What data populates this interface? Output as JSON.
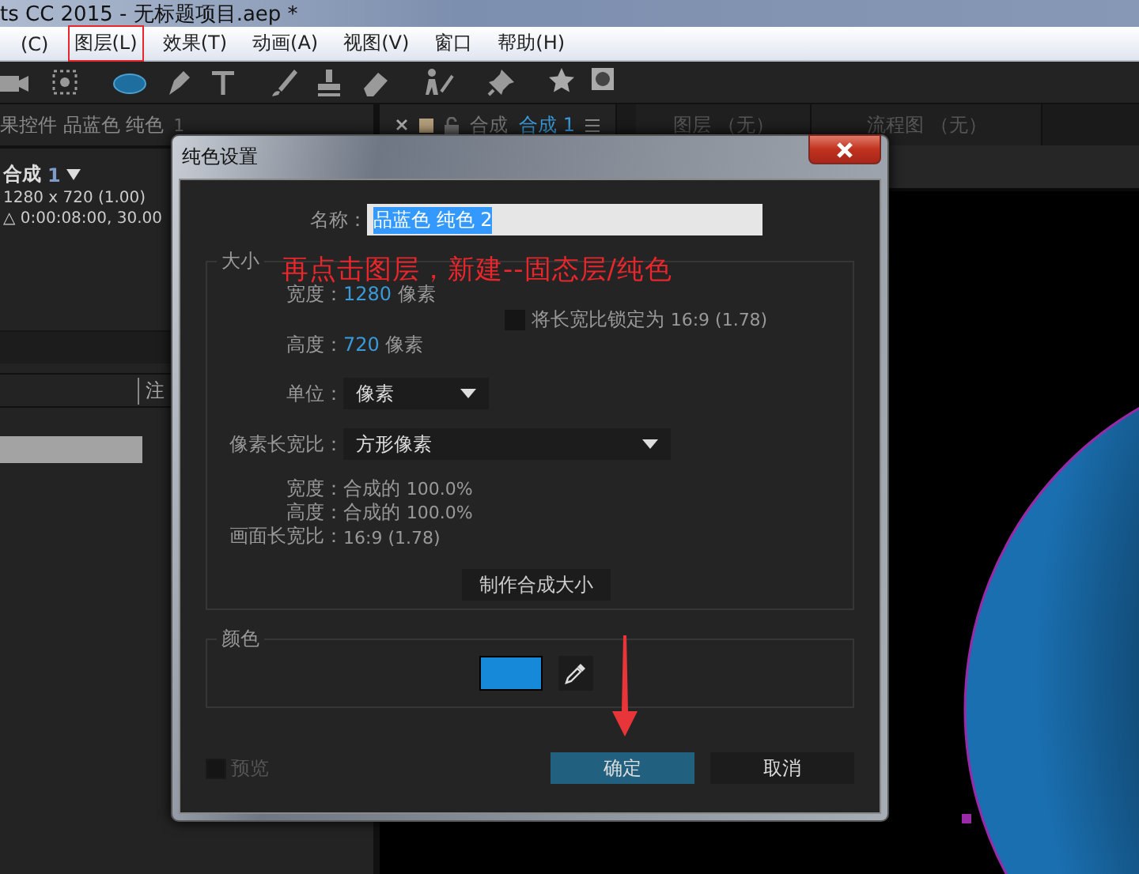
{
  "window": {
    "title": "ts CC 2015 - 无标题项目.aep *"
  },
  "menu": [
    {
      "label": "(C)",
      "annotated": false
    },
    {
      "label": "图层(L)",
      "annotated": true
    },
    {
      "label": "效果(T)",
      "annotated": false
    },
    {
      "label": "动画(A)",
      "annotated": false
    },
    {
      "label": "视图(V)",
      "annotated": false
    },
    {
      "label": "窗口",
      "annotated": false
    },
    {
      "label": "帮助(H)",
      "annotated": false
    }
  ],
  "left_panel": {
    "tab": "果控件 品蓝色 纯色",
    "tab_number": "1",
    "comp_name": "合成",
    "comp_number": "1",
    "info": [
      "1280 x 720 (1.00)",
      "△ 0:00:08:00, 30.00"
    ],
    "column_header": "注"
  },
  "viewer_tabs": [
    {
      "prefix": "合成",
      "label": "合成 1",
      "selected": true
    },
    {
      "label": "图层 （无）",
      "selected": false
    },
    {
      "label": "流程图 （无）",
      "selected": false
    }
  ],
  "dialog": {
    "title": "纯色设置",
    "name_label": "名称：",
    "name_value": "品蓝色 纯色 2",
    "name_selected": true,
    "size_group": "大小",
    "width": {
      "label": "宽度：",
      "value": "1280",
      "unit": "像素"
    },
    "height": {
      "label": "高度：",
      "value": "720",
      "unit": "像素"
    },
    "lock": {
      "label": "将长宽比锁定为",
      "value": "16:9 (1.78)",
      "checked": false
    },
    "units": {
      "label": "单位：",
      "value": "像素"
    },
    "pixel_aspect": {
      "label": "像素长宽比：",
      "value": "方形像素"
    },
    "info": [
      {
        "label": "宽度：",
        "text": "合成的",
        "value": "100.0%"
      },
      {
        "label": "高度：",
        "text": "合成的",
        "value": "100.0%"
      },
      {
        "label": "画面长宽比：",
        "value": "16:9 (1.78)"
      }
    ],
    "make_comp_size": "制作合成大小",
    "color_group": "颜色",
    "color": "#1689d8",
    "preview": {
      "label": "预览",
      "checked": false,
      "disabled": true
    },
    "buttons": [
      {
        "label": "确定",
        "kind": "primary",
        "annotated": true
      },
      {
        "label": "取消",
        "kind": "secondary",
        "annotated": false
      }
    ]
  },
  "annotation_text": "再点击图层，新建--固态层/纯色"
}
